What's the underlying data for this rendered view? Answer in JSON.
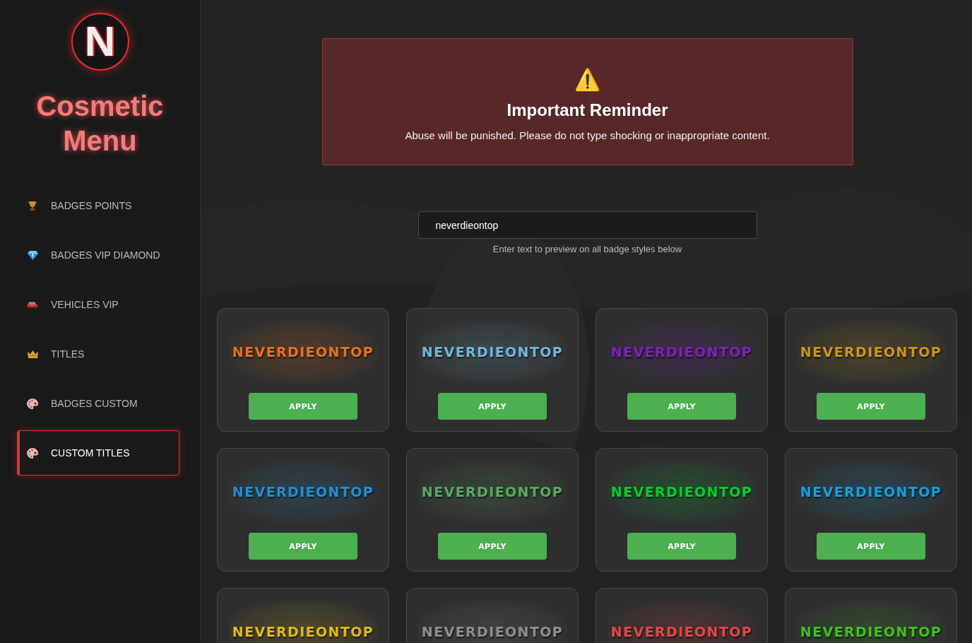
{
  "sidebar": {
    "logo_letter": "N",
    "title": "Cosmetic Menu",
    "items": [
      {
        "label": "BADGES POINTS",
        "selected": false
      },
      {
        "label": "BADGES VIP DIAMOND",
        "selected": false
      },
      {
        "label": "VEHICLES VIP",
        "selected": false
      },
      {
        "label": "TITLES",
        "selected": false
      },
      {
        "label": "BADGES CUSTOM",
        "selected": false
      },
      {
        "label": "CUSTOM TITLES",
        "selected": true
      }
    ]
  },
  "reminder": {
    "icon": "⚠️",
    "title": "Important Reminder",
    "message": "Abuse will be punished. Please do not type shocking or inappropriate content."
  },
  "preview": {
    "value": "neverdieontop",
    "hint": "Enter text to preview on all badge styles below"
  },
  "badges": [
    {
      "text": "NEVERDIEONTOP",
      "color": "#e8711c",
      "button": "APPLY"
    },
    {
      "text": "NEVERDIEONTOP",
      "color": "#74b4d4",
      "button": "APPLY"
    },
    {
      "text": "NEVERDIEONTOP",
      "color": "#7a22b8",
      "button": "APPLY"
    },
    {
      "text": "NEVERDIEONTOP",
      "color": "#c8961a",
      "button": "APPLY"
    },
    {
      "text": "NEVERDIEONTOP",
      "color": "#1e90d4",
      "button": "APPLY"
    },
    {
      "text": "NEVERDIEONTOP",
      "color": "#58a860",
      "button": "APPLY"
    },
    {
      "text": "NEVERDIEONTOP",
      "color": "#00d030",
      "button": "APPLY"
    },
    {
      "text": "NEVERDIEONTOP",
      "color": "#14a0e0",
      "button": "APPLY"
    },
    {
      "text": "NEVERDIEONTOP",
      "color": "#e0b818"
    },
    {
      "text": "NEVERDIEONTOP",
      "color": "#8e8e8e"
    },
    {
      "text": "NEVERDIEONTOP",
      "color": "#e04848"
    },
    {
      "text": "NEVERDIEONTOP",
      "color": "#40c020"
    }
  ]
}
